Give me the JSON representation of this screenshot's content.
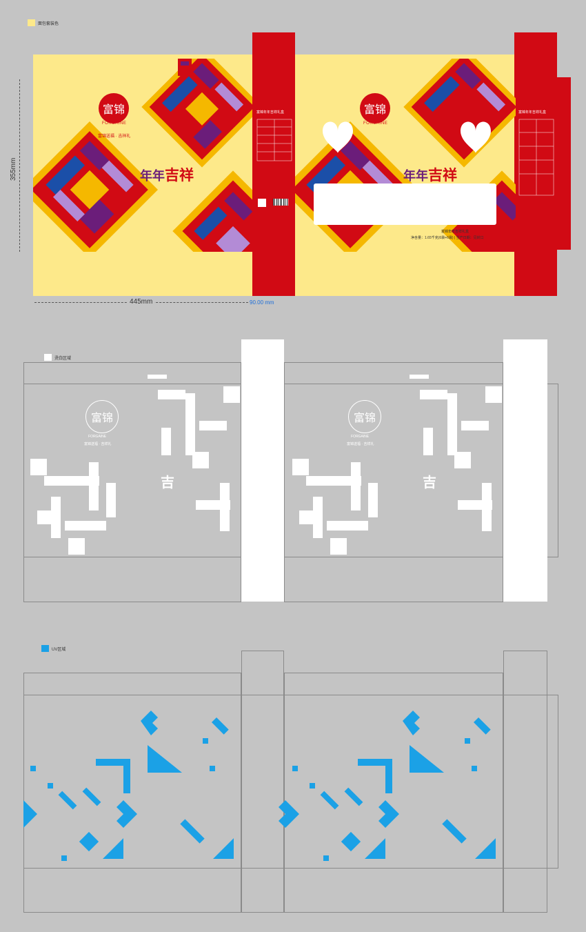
{
  "sections": {
    "color": {
      "legend_label": "面包套装色",
      "legend_color": "#fde98a",
      "height_label": "355mm",
      "width_label": "445mm",
      "side_width_label": "90.00 mm",
      "brand_name": "富锦",
      "brand_en": "FORGAINE",
      "slogan": "富锦送福 · 吉祥礼",
      "headline_main": "年年",
      "headline_red": "吉祥",
      "side_title": "富锦年年吉祥礼盒",
      "product_line": "富锦年年吉祥礼盒",
      "net_weight": "净含量：1.65千克(6袋+6袋) | 生产日期：见封口",
      "accent_red": "#d10a14"
    },
    "silver": {
      "legend_label": "烫白区域",
      "legend_color": "#ffffff",
      "brand_name": "富锦",
      "brand_en": "FORGAINE",
      "slogan": "富锦送福 · 吉祥礼",
      "ji": "吉"
    },
    "uv": {
      "legend_label": "UV区域",
      "legend_color": "#1ba1e6"
    }
  }
}
